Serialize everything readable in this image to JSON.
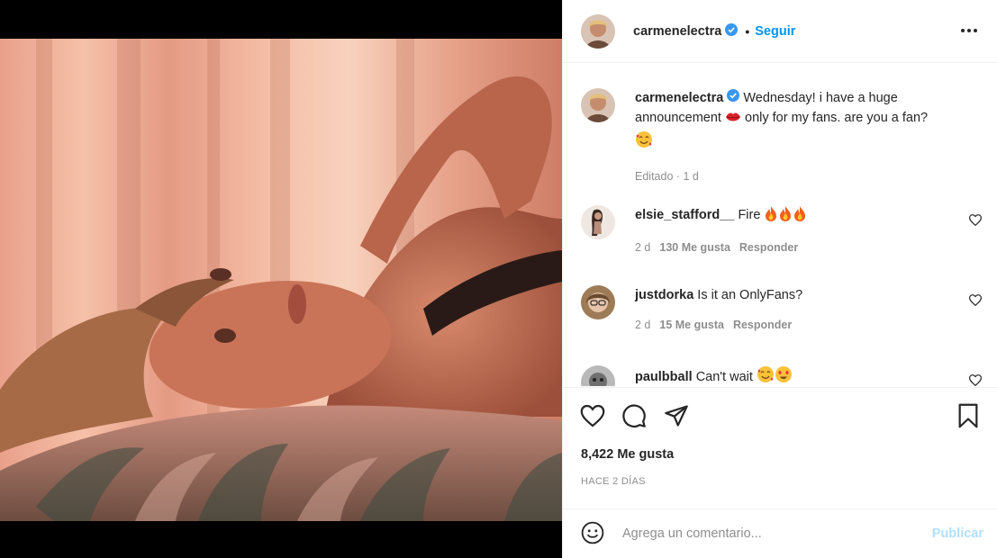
{
  "post": {
    "username": "carmenelectra",
    "follow_label": "Seguir",
    "separator": "•"
  },
  "caption": {
    "username": "carmenelectra",
    "text_part1": "Wednesday! i have a huge announcement",
    "text_part2": "only for my fans. are you a fan?",
    "meta": "Editado · 1 d"
  },
  "comments": [
    {
      "username": "elsie_stafford__",
      "text": "Fire",
      "time": "2 d",
      "likes": "130 Me gusta",
      "reply": "Responder",
      "emoji": [
        "fire",
        "fire",
        "fire"
      ]
    },
    {
      "username": "justdorka",
      "text": "Is it an OnlyFans?",
      "time": "2 d",
      "likes": "15 Me gusta",
      "reply": "Responder",
      "emoji": []
    },
    {
      "username": "paulbball",
      "text": "Can't wait",
      "emoji": [
        "smiling-face-with-hearts",
        "heart-eyes"
      ]
    }
  ],
  "stats": {
    "likes": "8,422 Me gusta",
    "timestamp": "HACE 2 DÍAS"
  },
  "composer": {
    "placeholder": "Agrega un comentario...",
    "publish_label": "Publicar"
  },
  "colors": {
    "link_blue": "#0095f6",
    "publish_disabled": "#b2dffc",
    "meta_gray": "#8e8e8e",
    "verified_blue": "#3897f0"
  }
}
